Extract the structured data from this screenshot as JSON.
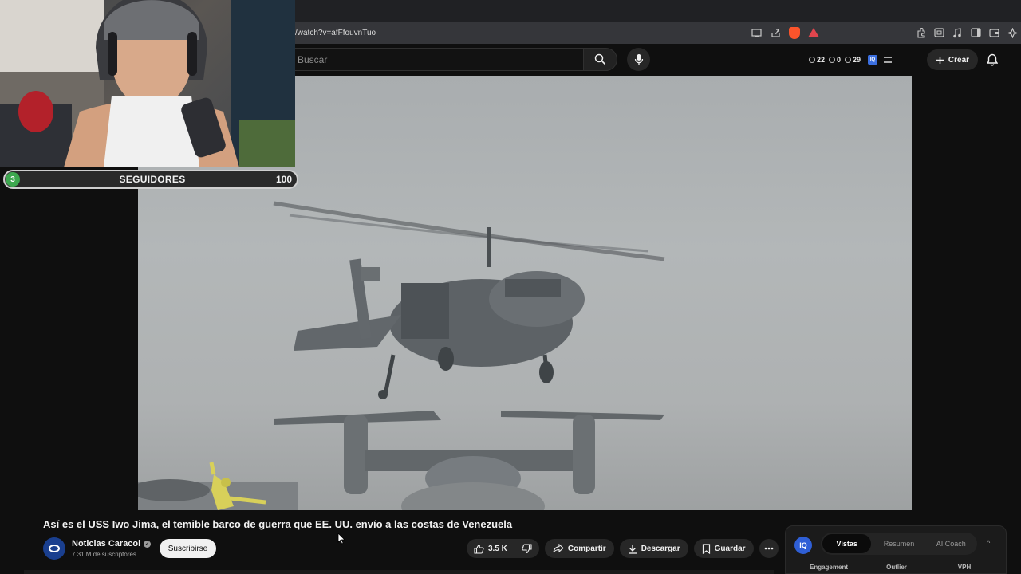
{
  "browser": {
    "url": "/watch?v=afFfouvnTuo",
    "icons": [
      "cast-icon",
      "share-icon",
      "brave-shield-icon",
      "brave-rewards-icon",
      "extensions-icon",
      "screenshot-icon",
      "music-icon",
      "sidebar-icon",
      "wallet-icon",
      "leo-ai-icon"
    ]
  },
  "header": {
    "search_placeholder": "Buscar",
    "stats": {
      "a": "22",
      "b": "0",
      "c": "29"
    },
    "create_label": "Crear"
  },
  "overlay": {
    "goal_label": "SEGUIDORES",
    "current": "3",
    "target": "100",
    "progress_fraction": 0.03
  },
  "video": {
    "title": "Así es el USS Iwo Jima, el temible barco de guerra que EE. UU. envío a las costas de Venezuela"
  },
  "channel": {
    "name": "Noticias Caracol",
    "subscribers": "7.31 M de suscriptores",
    "subscribe_label": "Suscribirse"
  },
  "actions": {
    "likes": "3.5 K",
    "share": "Compartir",
    "download": "Descargar",
    "save": "Guardar"
  },
  "extension": {
    "logo": "IQ",
    "tabs": [
      "Vistas",
      "Resumen",
      "AI Coach"
    ],
    "active_tab": "Vistas",
    "columns": [
      "Engagement",
      "Outlier",
      "VPH"
    ]
  },
  "colors": {
    "background": "#0f0f0f",
    "accent_green": "#3da84f",
    "extension_blue": "#2f5fd6"
  }
}
